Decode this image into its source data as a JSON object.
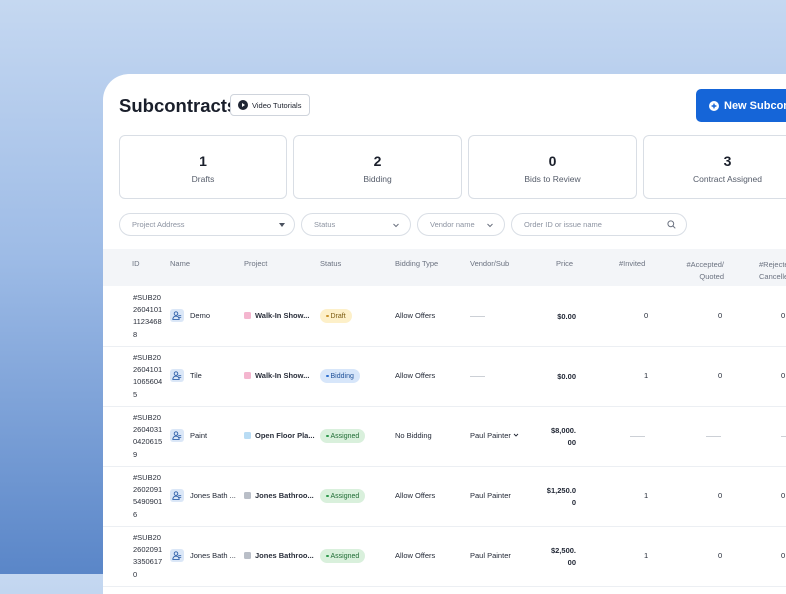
{
  "page": {
    "title": "Subcontracts",
    "video_button": "Video Tutorials",
    "new_button": "New Subcontract",
    "accent_color": "#1565d8"
  },
  "stats": [
    {
      "count": "1",
      "label": "Drafts"
    },
    {
      "count": "2",
      "label": "Bidding"
    },
    {
      "count": "0",
      "label": "Bids to Review"
    },
    {
      "count": "3",
      "label": "Contract Assigned"
    }
  ],
  "filters": {
    "project_address": "Project Address",
    "status": "Status",
    "vendor_name": "Vendor name",
    "search_placeholder": "Order ID or issue name"
  },
  "columns": {
    "id": "ID",
    "name": "Name",
    "project": "Project",
    "status": "Status",
    "bidding_type": "Bidding Type",
    "vendor": "Vendor/Sub",
    "price": "Price",
    "invited": "#Invited",
    "accepted_1": "#Accepted/",
    "accepted_2": "Quoted",
    "rejected_1": "#Rejected/",
    "rejected_2": "Cancelled"
  },
  "rows": [
    {
      "id": [
        "#SUB20",
        "2604101",
        "1123468",
        "8"
      ],
      "name": "Demo",
      "project": "Walk-In Show...",
      "project_color": "#f4b6cf",
      "status": "Draft",
      "bidding_type": "Allow Offers",
      "vendor": "——",
      "price": [
        "$0.00"
      ],
      "invited": "0",
      "accepted": "0",
      "rejected": "0"
    },
    {
      "id": [
        "#SUB20",
        "2604101",
        "1065604",
        "5"
      ],
      "name": "Tile",
      "project": "Walk-In Show...",
      "project_color": "#f4b6cf",
      "status": "Bidding",
      "bidding_type": "Allow Offers",
      "vendor": "——",
      "price": [
        "$0.00"
      ],
      "invited": "1",
      "accepted": "0",
      "rejected": "0"
    },
    {
      "id": [
        "#SUB20",
        "2604031",
        "0420615",
        "9"
      ],
      "name": "Paint",
      "project": "Open Floor Pla...",
      "project_color": "#b9dcf4",
      "status": "Assigned",
      "bidding_type": "No Bidding",
      "vendor": "Paul Painter",
      "price": [
        "$8,000.",
        "00"
      ],
      "invited": "——",
      "accepted": "——",
      "rejected": "——"
    },
    {
      "id": [
        "#SUB20",
        "2602091",
        "5490901",
        "6"
      ],
      "name": "Jones Bath ...",
      "project": "Jones Bathroo...",
      "project_color": "#b9bec7",
      "status": "Assigned",
      "bidding_type": "Allow Offers",
      "vendor": "Paul Painter",
      "price": [
        "$1,250.0",
        "0"
      ],
      "invited": "1",
      "accepted": "0",
      "rejected": "0"
    },
    {
      "id": [
        "#SUB20",
        "2602091",
        "3350617",
        "0"
      ],
      "name": "Jones Bath ...",
      "project": "Jones Bathroo...",
      "project_color": "#b9bec7",
      "status": "Assigned",
      "bidding_type": "Allow Offers",
      "vendor": "Paul Painter",
      "price": [
        "$2,500.",
        "00"
      ],
      "invited": "1",
      "accepted": "0",
      "rejected": "0"
    }
  ]
}
